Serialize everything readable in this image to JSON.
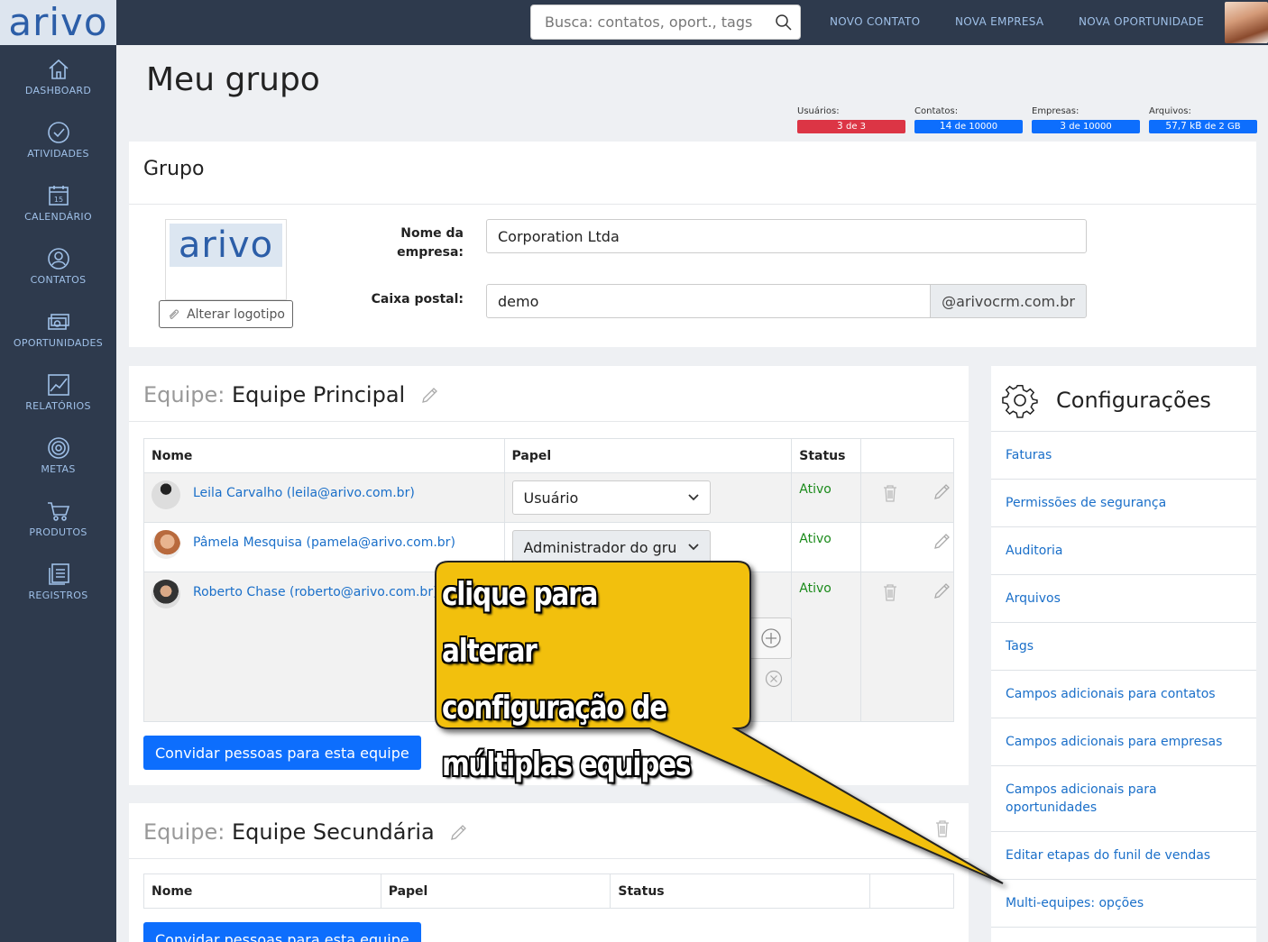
{
  "app": {
    "logo_text": "arivo"
  },
  "sidebar": {
    "items": [
      {
        "label": "DASHBOARD",
        "icon": "home-icon"
      },
      {
        "label": "ATIVIDADES",
        "icon": "check-circle-icon"
      },
      {
        "label": "CALENDÁRIO",
        "icon": "calendar-icon",
        "day": "15"
      },
      {
        "label": "CONTATOS",
        "icon": "person-icon"
      },
      {
        "label": "OPORTUNIDADES",
        "icon": "money-icon"
      },
      {
        "label": "RELATÓRIOS",
        "icon": "chart-icon"
      },
      {
        "label": "METAS",
        "icon": "target-icon"
      },
      {
        "label": "PRODUTOS",
        "icon": "cart-icon"
      },
      {
        "label": "REGISTROS",
        "icon": "records-icon"
      }
    ]
  },
  "topbar": {
    "search_placeholder": "Busca: contatos, oport., tags",
    "links": [
      "NOVO CONTATO",
      "NOVA EMPRESA",
      "NOVA OPORTUNIDADE"
    ]
  },
  "page": {
    "title": "Meu grupo"
  },
  "quotas": [
    {
      "label": "Usuários:",
      "value": "3",
      "of": "de 3",
      "color": "#dc3545",
      "fill": 1.0
    },
    {
      "label": "Contatos:",
      "value": "14",
      "of": "de 10000",
      "color": "#0d6efd",
      "fill": 0.0014
    },
    {
      "label": "Empresas:",
      "value": "3",
      "of": "de 10000",
      "color": "#0d6efd",
      "fill": 0.0003
    },
    {
      "label": "Arquivos:",
      "value": "57,7 kB",
      "of": "de 2 GB",
      "color": "#0d6efd",
      "fill": 3e-05
    }
  ],
  "group": {
    "title": "Grupo",
    "logo_text": "arivo",
    "change_logo_label": "Alterar logotipo",
    "company_label_line1": "Nome da",
    "company_label_line2": "empresa:",
    "company_value": "Corporation Ltda",
    "mailbox_label": "Caixa postal:",
    "mailbox_value": "demo",
    "mailbox_domain": "@arivocrm.com.br"
  },
  "team1": {
    "prefix": "Equipe:",
    "name": "Equipe Principal",
    "columns": [
      "Nome",
      "Papel",
      "Status",
      ""
    ],
    "rows": [
      {
        "user": "Leila Carvalho (leila@arivo.com.br)",
        "role": "Usuário",
        "status": "Ativo"
      },
      {
        "user": "Pâmela Mesquisa (pamela@arivo.com.br)",
        "role": "Administrador do gru",
        "status": "Ativo"
      },
      {
        "user": "Roberto Chase (roberto@arivo.com.br)",
        "role": "",
        "status": "Ativo"
      }
    ],
    "invite_label": "Convidar pessoas para esta equipe"
  },
  "team2": {
    "prefix": "Equipe:",
    "name": "Equipe Secundária",
    "columns": [
      "Nome",
      "Papel",
      "Status",
      ""
    ],
    "invite_label": "Convidar pessoas para esta equipe"
  },
  "config": {
    "title": "Configurações",
    "items": [
      "Faturas",
      "Permissões de segurança",
      "Auditoria",
      "Arquivos",
      "Tags",
      "Campos adicionais para contatos",
      "Campos adicionais para empresas",
      "Campos adicionais para oportunidades",
      "Editar etapas do funil de vendas",
      "Multi-equipes: opções"
    ]
  },
  "callout": {
    "lines": [
      "clique para alterar",
      "configuração de",
      "múltiplas equipes"
    ],
    "color": "#f2c010"
  }
}
